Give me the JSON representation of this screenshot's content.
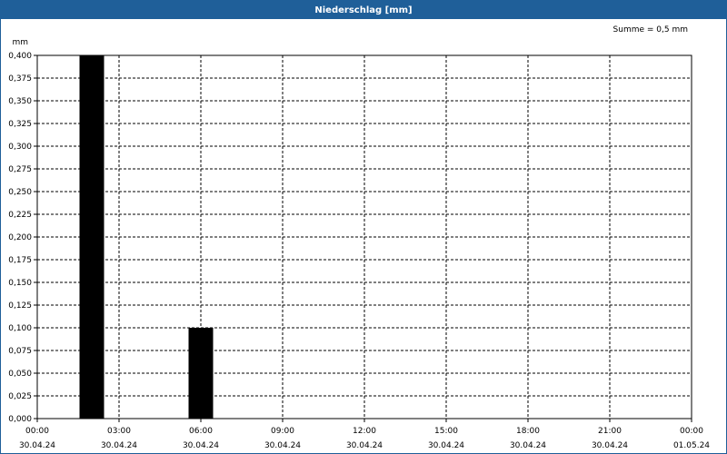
{
  "window": {
    "title": "Niederschlag [mm]"
  },
  "chart_data": {
    "type": "bar",
    "title": "Niederschlag [mm]",
    "ylabel": "mm",
    "summary": "Summe = 0,5 mm",
    "ylim": [
      0,
      0.4
    ],
    "xlim": [
      0,
      24
    ],
    "y_ticks": [
      "0,000",
      "0,025",
      "0,050",
      "0,075",
      "0,100",
      "0,125",
      "0,150",
      "0,175",
      "0,200",
      "0,225",
      "0,250",
      "0,275",
      "0,300",
      "0,325",
      "0,350",
      "0,375",
      "0,400"
    ],
    "x_ticks": [
      {
        "time": "00:00",
        "date": "30.04.24"
      },
      {
        "time": "03:00",
        "date": "30.04.24"
      },
      {
        "time": "06:00",
        "date": "30.04.24"
      },
      {
        "time": "09:00",
        "date": "30.04.24"
      },
      {
        "time": "12:00",
        "date": "30.04.24"
      },
      {
        "time": "15:00",
        "date": "30.04.24"
      },
      {
        "time": "18:00",
        "date": "30.04.24"
      },
      {
        "time": "21:00",
        "date": "30.04.24"
      },
      {
        "time": "00:00",
        "date": "01.05.24"
      }
    ],
    "bars": [
      {
        "x": "30.04.24 02:00",
        "value": 0.4
      },
      {
        "x": "30.04.24 06:00",
        "value": 0.1
      }
    ],
    "bar_color": "#000000",
    "grid": true
  }
}
